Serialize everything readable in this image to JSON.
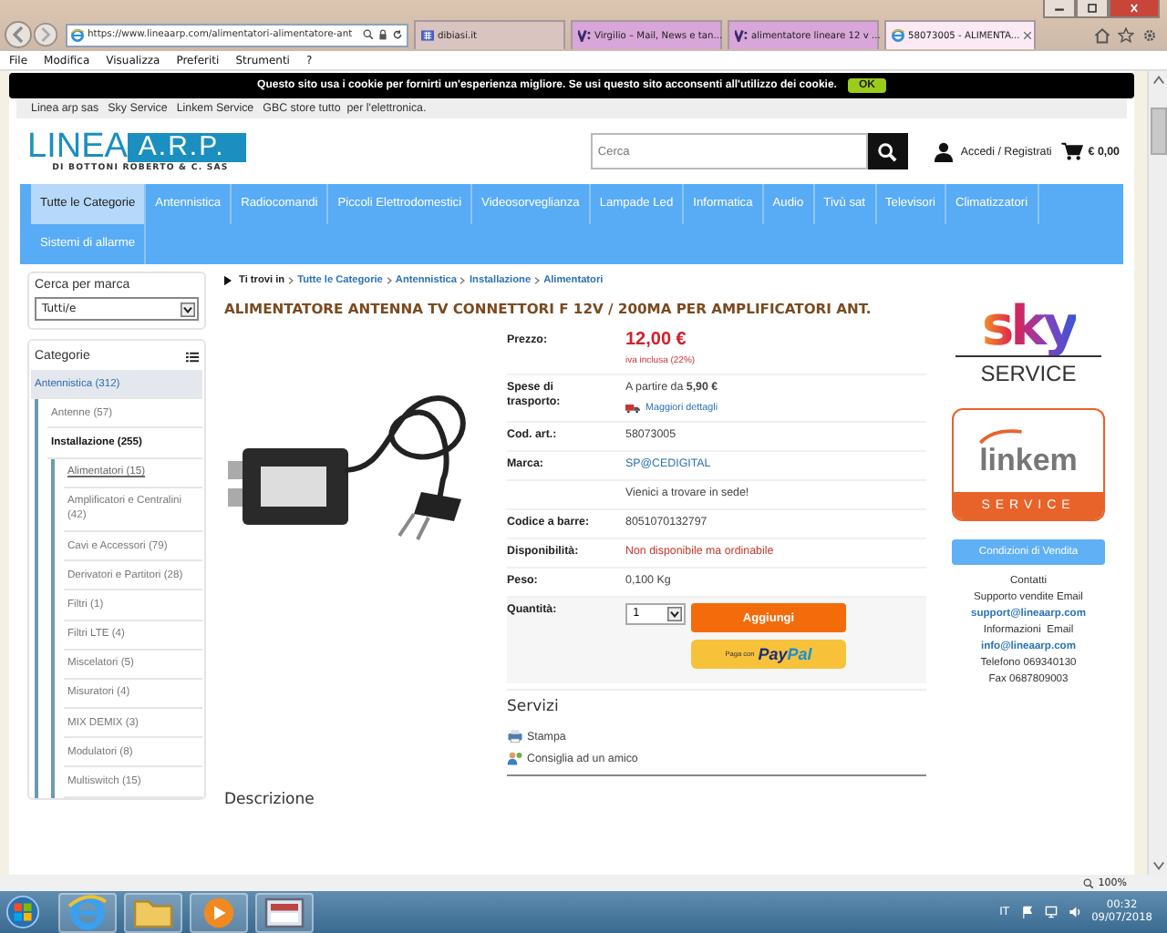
{
  "browser": {
    "address": "https://www.lineaarp.com/alimentatori-alimentatore-ant",
    "tabs": [
      {
        "title": "dibiasi.it",
        "kind": "grid",
        "selected": false
      },
      {
        "title": "Virgilio – Mail, News e tan...",
        "kind": "v",
        "selected": false
      },
      {
        "title": "alimentatore lineare 12 v ...",
        "kind": "v",
        "selected": false
      },
      {
        "title": "58073005 - ALIMENTA...",
        "kind": "ie",
        "selected": true
      }
    ],
    "menu": [
      "File",
      "Modifica",
      "Visualizza",
      "Preferiti",
      "Strumenti",
      "?"
    ],
    "zoom": "100%"
  },
  "cookie_bar": {
    "text": "Questo sito usa i cookie per fornirti un'esperienza migliore. Se usi questo sito acconsenti all'utilizzo dei cookie.",
    "button": "OK"
  },
  "top_links": [
    "Linea arp sas",
    "Sky Service",
    "Linkem Service",
    "GBC store tutto  per l'elettronica."
  ],
  "header": {
    "logo_main": "LINEA",
    "logo_accent": "A.R.P.",
    "logo_sub": "DI BOTTONI ROBERTO & C. SAS",
    "search_placeholder": "Cerca",
    "account": "Accedi / Registrati",
    "cart": "€ 0,00"
  },
  "nav": [
    {
      "label": "Tutte le Categorie",
      "selected": true
    },
    {
      "label": "Antennistica",
      "selected": false
    },
    {
      "label": "Radiocomandi",
      "selected": false
    },
    {
      "label": "Piccoli Elettrodomestici",
      "selected": false
    },
    {
      "label": "Videosorveglianza",
      "selected": false
    },
    {
      "label": "Lampade Led",
      "selected": false
    },
    {
      "label": "Informatica",
      "selected": false
    },
    {
      "label": "Audio",
      "selected": false
    },
    {
      "label": "Tivù sat",
      "selected": false
    },
    {
      "label": "Televisori",
      "selected": false
    },
    {
      "label": "Climatizzatori",
      "selected": false
    },
    {
      "label": "Sistemi di allarme",
      "selected": false
    }
  ],
  "sidebar": {
    "brand_title": "Cerca per marca",
    "brand_select": "Tutti/e",
    "categories_title": "Categorie",
    "categories": [
      {
        "label": "Antennistica (312)",
        "selected": true,
        "children": [
          {
            "label": "Antenne (57)",
            "selected": false
          },
          {
            "label": "Installazione (255)",
            "selected": true,
            "children": [
              {
                "label": "Alimentatori (15)",
                "selected": true
              },
              {
                "label": "Amplificatori e Centralini (42)",
                "selected": false
              },
              {
                "label": "Cavi e Accessori (79)",
                "selected": false
              },
              {
                "label": "Derivatori e Partitori (28)",
                "selected": false
              },
              {
                "label": "Filtri (1)",
                "selected": false
              },
              {
                "label": "Filtri LTE (4)",
                "selected": false
              },
              {
                "label": "Miscelatori (5)",
                "selected": false
              },
              {
                "label": "Misuratori (4)",
                "selected": false
              },
              {
                "label": "MIX DEMIX (3)",
                "selected": false
              },
              {
                "label": "Modulatori (8)",
                "selected": false
              },
              {
                "label": "Multiswitch (15)",
                "selected": false
              }
            ]
          }
        ]
      }
    ]
  },
  "product": {
    "breadcrumb_label": "Ti trovi in",
    "breadcrumb": [
      "Tutte le Categorie",
      "Antennistica",
      "Installazione",
      "Alimentatori"
    ],
    "title": "ALIMENTATORE ANTENNA TV CONNETTORI F 12V / 200MA PER AMPLIFICATORI ANT.",
    "details": [
      {
        "kind": "price",
        "label": "Prezzo:",
        "value": "12,00 €",
        "note": "iva inclusa (22%)"
      },
      {
        "kind": "shipping",
        "label": "Spese di trasporto:",
        "value": "A partire da **5,90 €**",
        "link": "Maggiori dettagli"
      },
      {
        "kind": "text",
        "label": "Cod. art.:",
        "value": "58073005"
      },
      {
        "kind": "link",
        "label": "Marca:",
        "value": "SP@CEDIGITAL"
      },
      {
        "kind": "text",
        "value": "Vienici a trovare in sede!"
      },
      {
        "kind": "text",
        "label": "Codice a barre:",
        "value": "8051070132797"
      },
      {
        "kind": "alert",
        "label": "Disponibilità:",
        "value": "Non disponibile ma ordinabile"
      },
      {
        "kind": "text",
        "label": "Peso:",
        "value": "0,100 Kg"
      }
    ],
    "quantity": {
      "label": "Quantità:",
      "value": "1",
      "add_button": "Aggiungi",
      "paypal_prefix": "Paga con",
      "paypal_pay": "Pay",
      "paypal_pal": "Pal"
    },
    "services": {
      "title": "Servizi",
      "items": [
        {
          "kind": "print",
          "label": "Stampa"
        },
        {
          "kind": "friend",
          "label": "Consiglia ad un amico"
        }
      ]
    },
    "description_title": "Descrizione"
  },
  "aside": {
    "sky_word": "sky",
    "sky_caption": "SERVICE",
    "linkem_word": "linkem",
    "linkem_caption": "SERVICE",
    "sales_button": "Condizioni di Vendita",
    "contacts": [
      {
        "kind": "text",
        "text": "Contatti"
      },
      {
        "kind": "text",
        "text": "Supporto vendite Email"
      },
      {
        "kind": "link",
        "text": "support@lineaarp.com"
      },
      {
        "kind": "text",
        "text": "Informazioni  Email"
      },
      {
        "kind": "link",
        "text": "info@lineaarp.com"
      },
      {
        "kind": "text",
        "text": "Telefono 069340130"
      },
      {
        "kind": "text",
        "text": "Fax 0687809003"
      }
    ]
  },
  "taskbar": {
    "apps": [
      {
        "kind": "ie"
      },
      {
        "kind": "folder"
      },
      {
        "kind": "media"
      },
      {
        "kind": "slides"
      }
    ],
    "language": "IT",
    "time": "00:32",
    "date": "09/07/2018"
  }
}
